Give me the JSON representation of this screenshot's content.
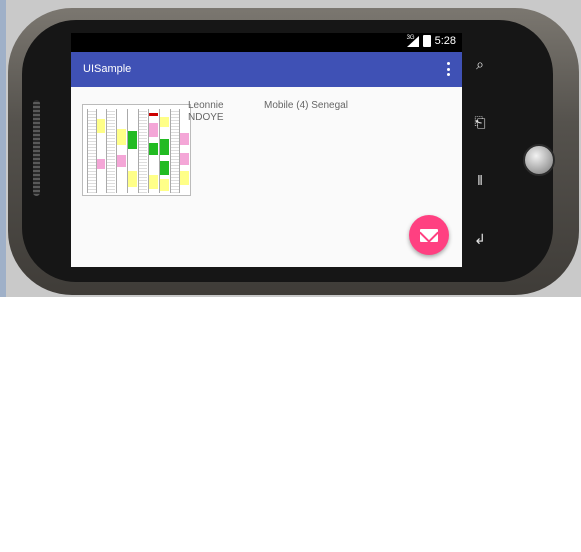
{
  "status_bar": {
    "time": "5:28",
    "network": "3G"
  },
  "app_bar": {
    "title": "UISample"
  },
  "list": [
    {
      "first_name": "Leonnie",
      "last_name": "NDOYE",
      "detail": "Mobile (4) Senegal"
    }
  ],
  "fab": {
    "icon": "email-icon",
    "color": "#ff4081"
  },
  "colors": {
    "app_bar": "#3f51b5",
    "status_bar": "#000000",
    "screen_bg": "#fafafa"
  },
  "hardware_buttons": [
    "search-icon",
    "back-icon",
    "menu-icon",
    "home-icon"
  ]
}
